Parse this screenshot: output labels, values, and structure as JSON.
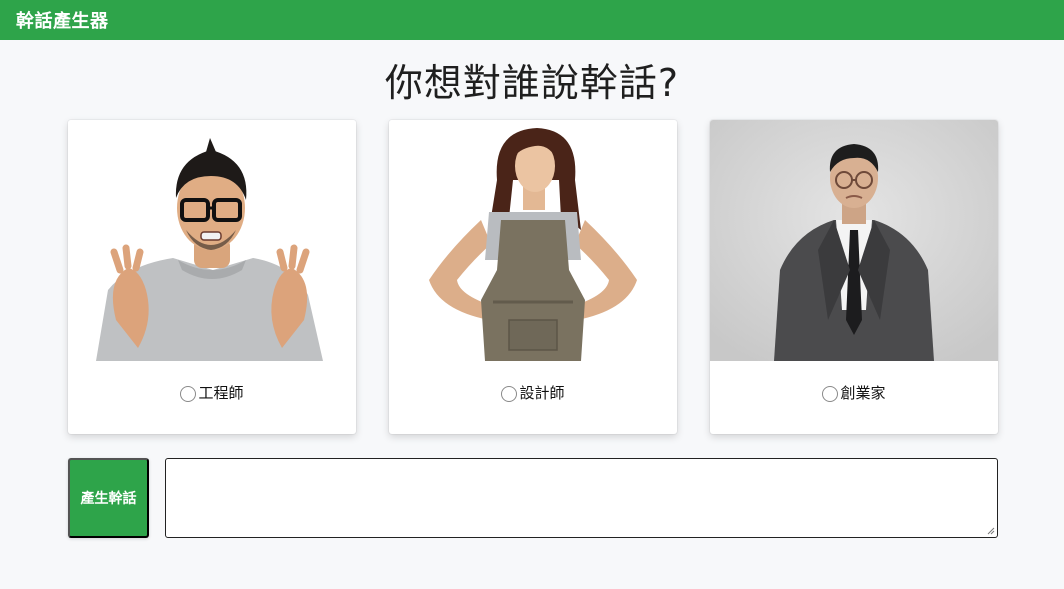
{
  "navbar": {
    "brand": "幹話產生器"
  },
  "main": {
    "heading": "你想對誰說幹話?",
    "options": [
      {
        "label": "工程師",
        "icon": "engineer-photo",
        "selected": false
      },
      {
        "label": "設計師",
        "icon": "designer-photo",
        "selected": false
      },
      {
        "label": "創業家",
        "icon": "entrepreneur-photo",
        "selected": false
      }
    ],
    "generate_label": "產生幹話",
    "output_value": ""
  },
  "colors": {
    "accent": "#2ea44a",
    "background": "#f7f8fa"
  }
}
